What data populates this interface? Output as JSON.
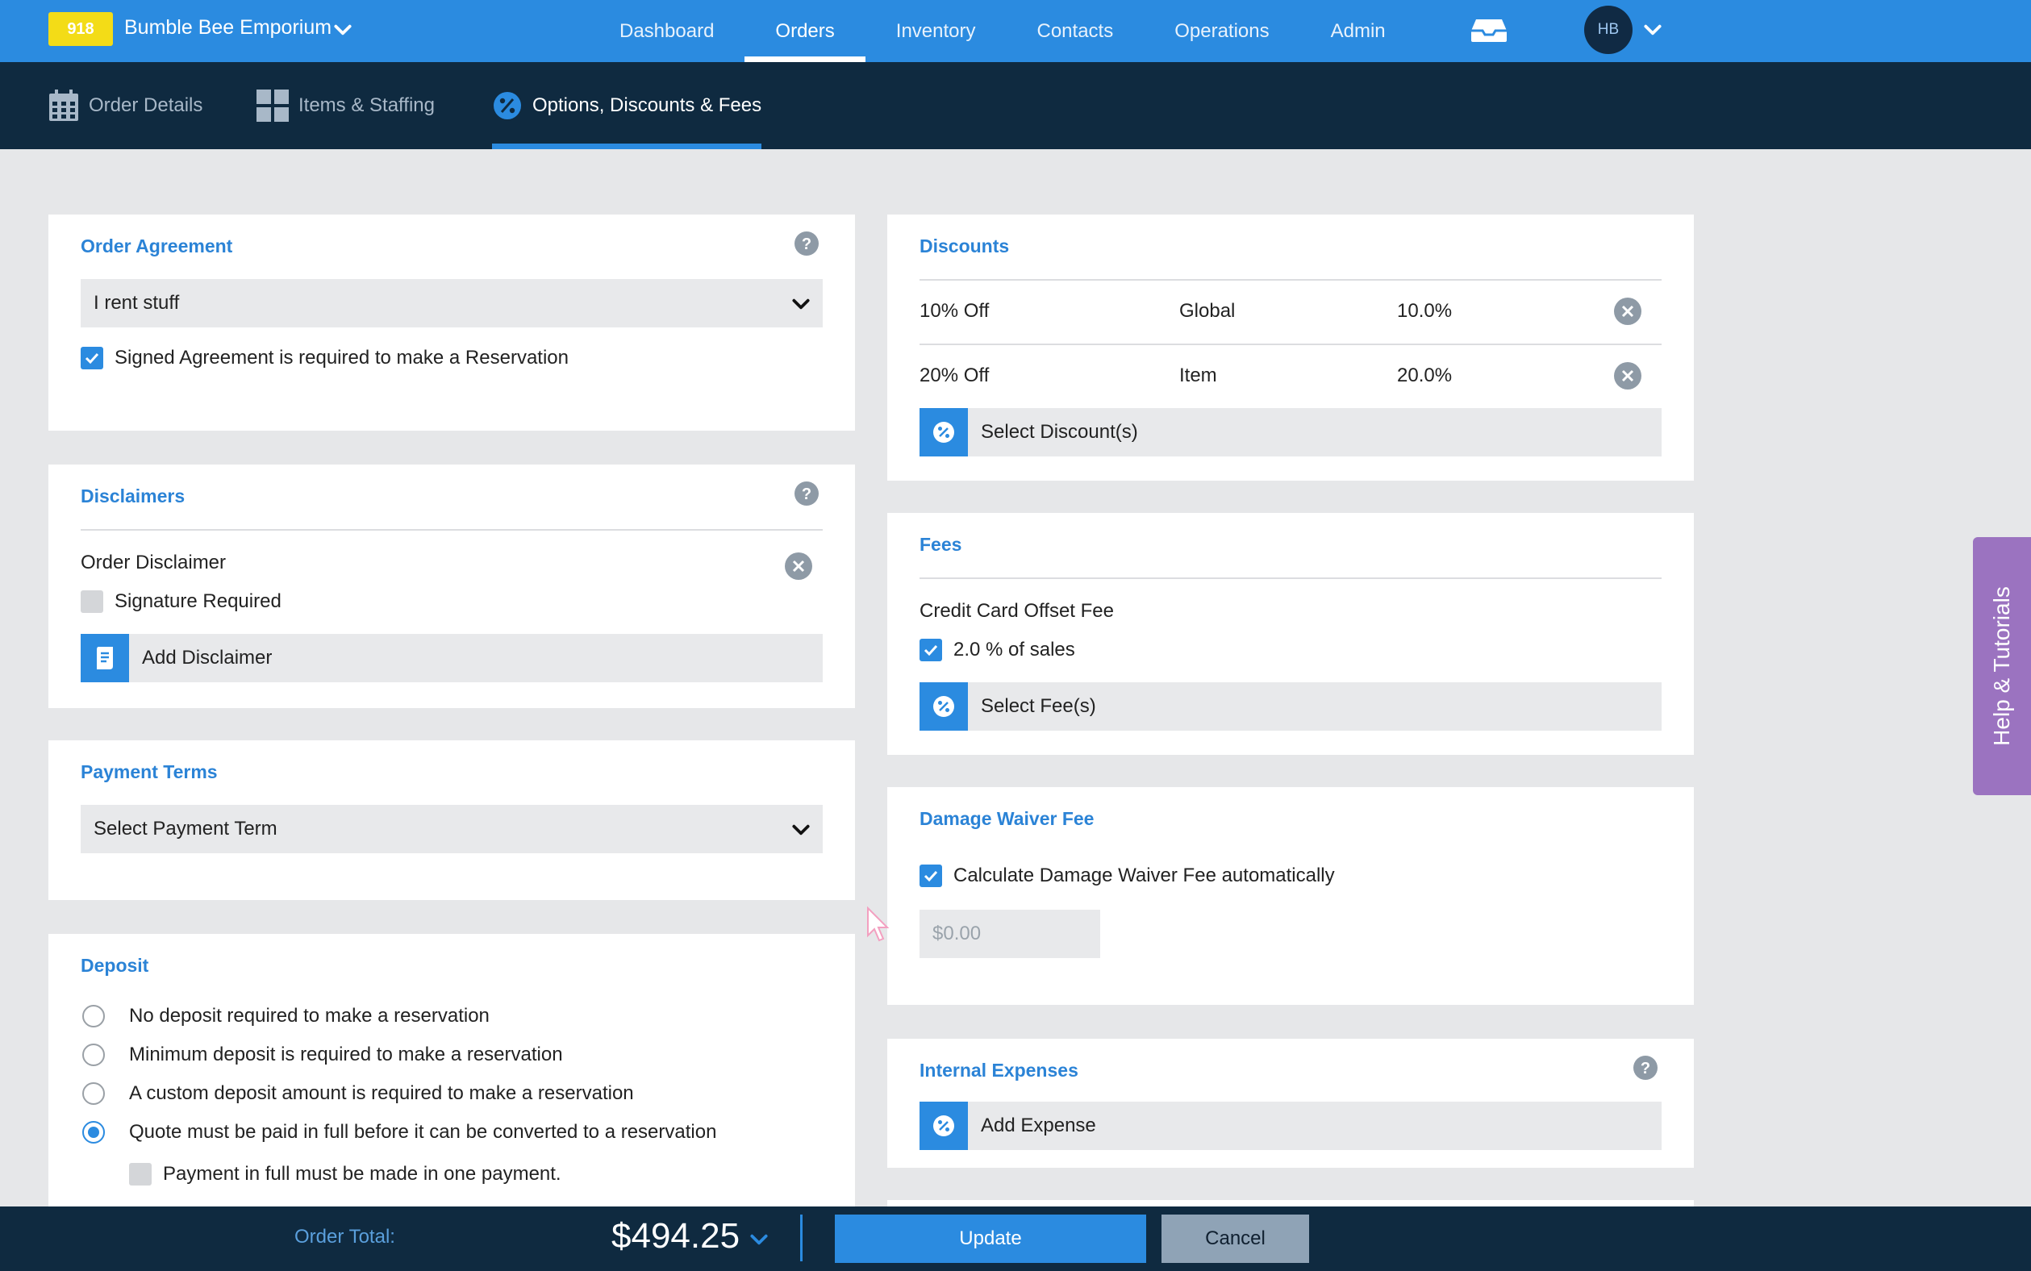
{
  "brand": {
    "badge": "918",
    "name": "Bumble Bee Emporium"
  },
  "nav": {
    "items": [
      "Dashboard",
      "Orders",
      "Inventory",
      "Contacts",
      "Operations",
      "Admin"
    ],
    "active": "Orders"
  },
  "user": {
    "initials": "HB"
  },
  "subnav": {
    "order_details": "Order Details",
    "items_staffing": "Items & Staffing",
    "options": "Options, Discounts & Fees"
  },
  "order_agreement": {
    "title": "Order Agreement",
    "selected": "I rent stuff",
    "signed_label": "Signed Agreement is required to make a Reservation",
    "signed_checked": true
  },
  "disclaimers": {
    "title": "Disclaimers",
    "item_name": "Order Disclaimer",
    "signature_label": "Signature Required",
    "signature_checked": false,
    "add_label": "Add Disclaimer"
  },
  "payment_terms": {
    "title": "Payment Terms",
    "placeholder": "Select Payment Term"
  },
  "deposit": {
    "title": "Deposit",
    "options": [
      "No deposit required to make a reservation",
      "Minimum deposit is required to make a reservation",
      "A custom deposit amount is required to make a reservation",
      "Quote must be paid in full before it can be converted to a reservation"
    ],
    "selected_index": 3,
    "one_payment_label": "Payment in full must be made in one payment.",
    "one_payment_checked": false
  },
  "discounts": {
    "title": "Discounts",
    "rows": [
      {
        "name": "10% Off",
        "scope": "Global",
        "amount": "10.0%"
      },
      {
        "name": "20% Off",
        "scope": "Item",
        "amount": "20.0%"
      }
    ],
    "select_label": "Select Discount(s)"
  },
  "fees": {
    "title": "Fees",
    "item_name": "Credit Card Offset Fee",
    "sales_label": "2.0 % of sales",
    "sales_checked": true,
    "select_label": "Select Fee(s)"
  },
  "damage_waiver": {
    "title": "Damage Waiver Fee",
    "auto_label": "Calculate Damage Waiver Fee automatically",
    "auto_checked": true,
    "amount_placeholder": "$0.00"
  },
  "internal_expenses": {
    "title": "Internal Expenses",
    "add_label": "Add Expense"
  },
  "help_tab": "Help & Tutorials",
  "footer": {
    "total_label": "Order Total:",
    "total": "$494.25",
    "update_label": "Update",
    "cancel_label": "Cancel"
  },
  "colors": {
    "primary": "#2b8be0",
    "dark": "#0f2a40",
    "brand_badge": "#f3dc17",
    "help_tab": "#9b73c0"
  }
}
